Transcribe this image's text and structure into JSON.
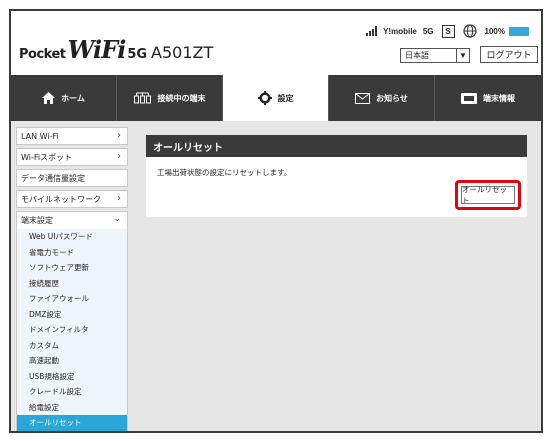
{
  "header": {
    "logo": {
      "pocket": "Pocket",
      "wifi": "WiFi",
      "fiveg": "5G",
      "model": "A501ZT"
    },
    "status": {
      "carrier": "Y!mobile",
      "network": "5G",
      "sim_label": "S",
      "battery_percent": "100%",
      "icons": [
        "signal-icon",
        "sim-icon",
        "globe-icon",
        "battery-icon"
      ]
    },
    "language_select": {
      "value": "日本語"
    },
    "logout_label": "ログアウト"
  },
  "nav": {
    "items": [
      {
        "label": "ホーム",
        "icon": "home-icon"
      },
      {
        "label": "接続中の端末",
        "icon": "devices-icon"
      },
      {
        "label": "設定",
        "icon": "gear-icon"
      },
      {
        "label": "お知らせ",
        "icon": "mail-icon"
      },
      {
        "label": "端末情報",
        "icon": "device-info-icon"
      }
    ],
    "active_index": 2
  },
  "sidebar": {
    "items": [
      {
        "label": "LAN Wi-Fi"
      },
      {
        "label": "Wi-Fiスポット"
      },
      {
        "label": "データ通信量設定"
      },
      {
        "label": "モバイルネットワーク"
      }
    ],
    "group": {
      "label": "端末設定",
      "items": [
        {
          "label": "Web UIパスワード"
        },
        {
          "label": "省電力モード"
        },
        {
          "label": "ソフトウェア更新"
        },
        {
          "label": "接続履歴"
        },
        {
          "label": "ファイアウォール"
        },
        {
          "label": "DMZ設定"
        },
        {
          "label": "ドメインフィルタ"
        },
        {
          "label": "カスタム"
        },
        {
          "label": "高速起動"
        },
        {
          "label": "USB規格設定"
        },
        {
          "label": "クレードル設定"
        },
        {
          "label": "給電設定"
        },
        {
          "label": "オールリセット"
        }
      ]
    }
  },
  "panel": {
    "title": "オールリセット",
    "description": "工場出荷状態の設定にリセットします。",
    "reset_button_label": "オールリセット"
  },
  "colors": {
    "nav_bg": "#3a3a3a",
    "content_bg": "#e6e6e6",
    "selected_item": "#2aa7d6",
    "highlight": "#e50012",
    "battery": "#35a8d8"
  }
}
